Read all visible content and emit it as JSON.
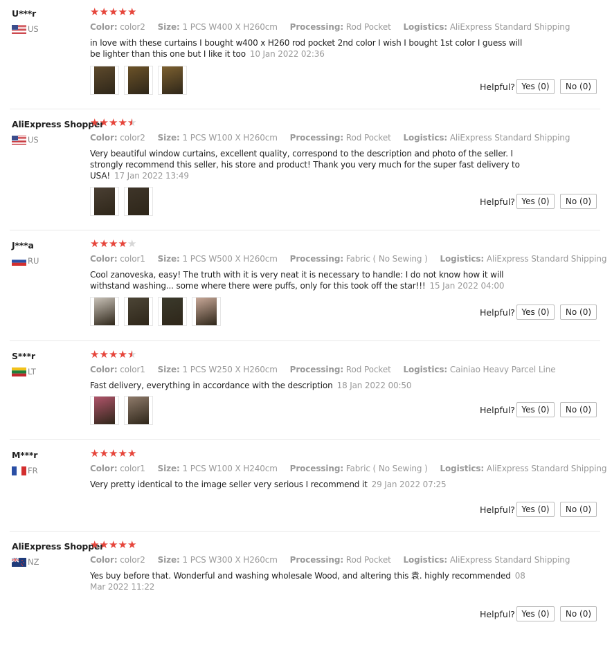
{
  "labels": {
    "color": "Color:",
    "size": "Size:",
    "processing": "Processing:",
    "logistics": "Logistics:",
    "helpful": "Helpful?",
    "yes": "Yes (0)",
    "no": "No (0)"
  },
  "reviews": [
    {
      "user": "U***r",
      "country": "US",
      "rating": 5,
      "color": "color2",
      "size": "1 PCS W400 X H260cm",
      "processing": "Rod Pocket",
      "logistics": "AliExpress Standard Shipping",
      "text": "in love with these curtains I bought w400 x H260 rod pocket 2nd color I wish I bought 1st color I guess will be lighter than this one but I like it too",
      "date": "10 Jan 2022 02:36",
      "photos": [
        "#5e4a2c",
        "#6b5228",
        "#7c6030"
      ]
    },
    {
      "user": "AliExpress Shopper",
      "country": "US",
      "rating": 4.5,
      "color": "color2",
      "size": "1 PCS W100 X H260cm",
      "processing": "Rod Pocket",
      "logistics": "AliExpress Standard Shipping",
      "text": "Very beautiful window curtains, excellent quality, correspond to the description and photo of the seller. I strongly recommend this seller, his store and product! Thank you very much for the super fast delivery to USA!",
      "date": "17 Jan 2022 13:49",
      "photos": [
        "#4a3f33",
        "#3e3529"
      ]
    },
    {
      "user": "J***a",
      "country": "RU",
      "rating": 4,
      "color": "color1",
      "size": "1 PCS W500 X H260cm",
      "processing": "Fabric ( No Sewing )",
      "logistics": "AliExpress Standard Shipping",
      "text": "Cool zanoveska, easy! The truth with it is very neat it is necessary to handle: I do not know how it will withstand washing... some where there were puffs, only for this took off the star!!!",
      "date": "15 Jan 2022 04:00",
      "photos": [
        "#c9c2b8",
        "#4c4536",
        "#3b3a2c",
        "#c8a898"
      ]
    },
    {
      "user": "S***r",
      "country": "LT",
      "rating": 4.5,
      "color": "color1",
      "size": "1 PCS W250 X H260cm",
      "processing": "Rod Pocket",
      "logistics": "Cainiao Heavy Parcel Line",
      "text": "Fast delivery, everything in accordance with the description",
      "date": "18 Jan 2022 00:50",
      "photos": [
        "#b0546a",
        "#8e7a6a"
      ]
    },
    {
      "user": "M***r",
      "country": "FR",
      "rating": 5,
      "color": "color1",
      "size": "1 PCS W100 X H240cm",
      "processing": "Fabric ( No Sewing )",
      "logistics": "AliExpress Standard Shipping",
      "text": "Very pretty identical to the image seller very serious I recommend it",
      "date": "29 Jan 2022 07:25",
      "photos": []
    },
    {
      "user": "AliExpress Shopper",
      "country": "NZ",
      "rating": 5,
      "color": "color2",
      "size": "1 PCS W300 X H260cm",
      "processing": "Rod Pocket",
      "logistics": "AliExpress Standard Shipping",
      "text": "Yes buy before that. Wonderful and washing wholesale Wood, and altering this 袁. highly recommended",
      "date": "08 Mar 2022 11:22",
      "photos": []
    }
  ]
}
